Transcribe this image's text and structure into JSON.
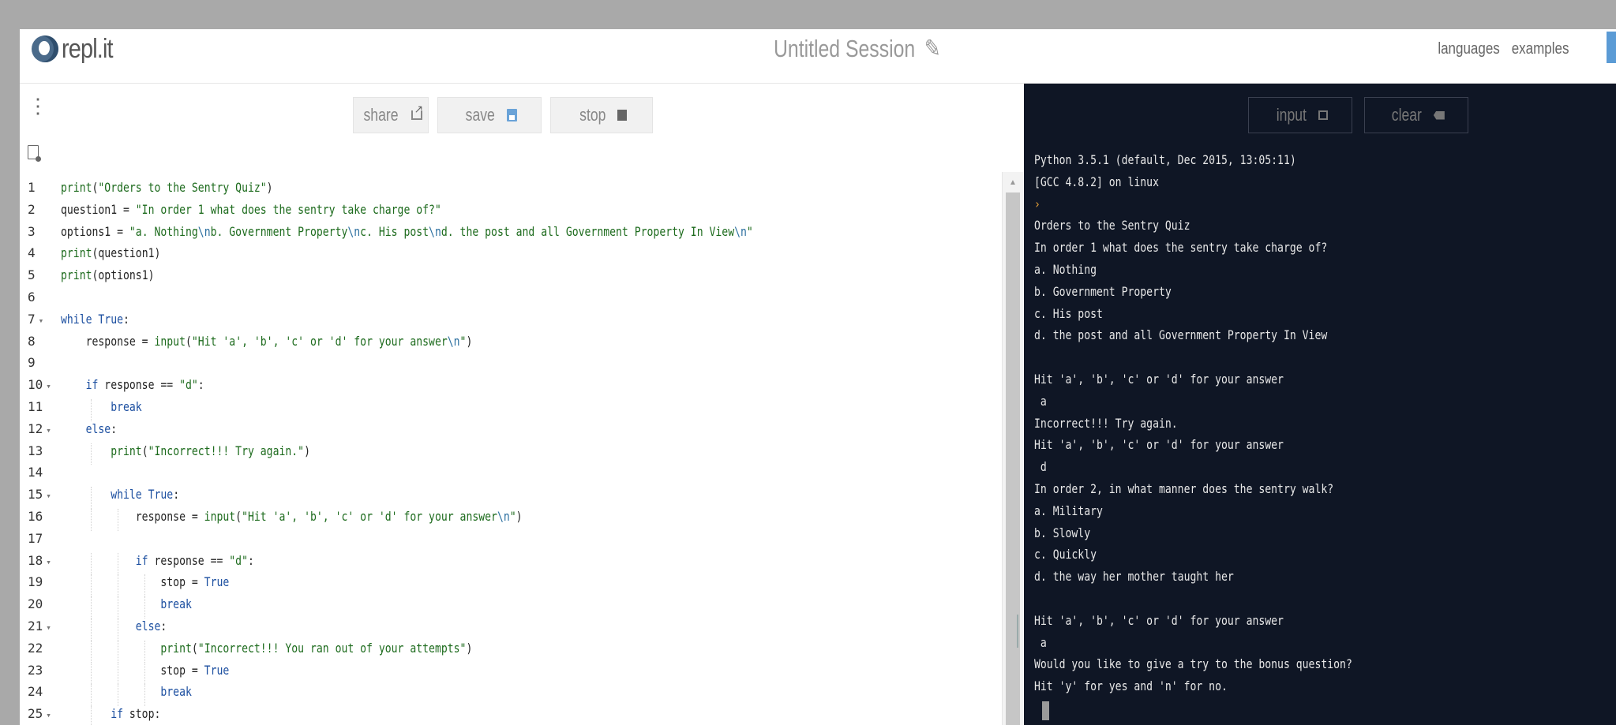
{
  "header": {
    "logo_text": "repl.it",
    "session_title": "Untitled Session",
    "nav": [
      "languages",
      "examples"
    ]
  },
  "toolbar": {
    "share_label": "share",
    "save_label": "save",
    "stop_label": "stop"
  },
  "console_toolbar": {
    "input_label": "input",
    "clear_label": "clear"
  },
  "editor": {
    "line_numbers": [
      "1",
      "2",
      "3",
      "4",
      "5",
      "6",
      "7",
      "8",
      "9",
      "10",
      "11",
      "12",
      "13",
      "14",
      "15",
      "16",
      "17",
      "18",
      "19",
      "20",
      "21",
      "22",
      "23",
      "24",
      "25"
    ],
    "folded_lines": [
      "7",
      "10",
      "12",
      "15",
      "18",
      "21",
      "25"
    ],
    "lines": [
      "print(\"Orders to the Sentry Quiz\")",
      "question1 = \"In order 1 what does the sentry take charge of?\"",
      "options1 = \"a. Nothing\\nb. Government Property\\nc. His post\\nd. the post and all Government Property In View\\n\"",
      "print(question1)",
      "print(options1)",
      "",
      "while True:",
      "    response = input(\"Hit 'a', 'b', 'c' or 'd' for your answer\\n\")",
      "",
      "    if response == \"d\":",
      "        break",
      "    else:",
      "        print(\"Incorrect!!! Try again.\")",
      "",
      "        while True:",
      "            response = input(\"Hit 'a', 'b', 'c' or 'd' for your answer\\n\")",
      "",
      "            if response == \"d\":",
      "                stop = True",
      "                break",
      "            else:",
      "                print(\"Incorrect!!! You ran out of your attempts\")",
      "                stop = True",
      "                break",
      "        if stop:"
    ]
  },
  "console": {
    "lines": [
      "Python 3.5.1 (default, Dec 2015, 13:05:11)",
      "[GCC 4.8.2] on linux",
      "›",
      "Orders to the Sentry Quiz",
      "In order 1 what does the sentry take charge of?",
      "a. Nothing",
      "b. Government Property",
      "c. His post",
      "d. the post and all Government Property In View",
      "",
      "Hit 'a', 'b', 'c' or 'd' for your answer",
      " a",
      "Incorrect!!! Try again.",
      "Hit 'a', 'b', 'c' or 'd' for your answer",
      " d",
      "In order 2, in what manner does the sentry walk?",
      "a. Military",
      "b. Slowly",
      "c. Quickly",
      "d. the way her mother taught her",
      "",
      "Hit 'a', 'b', 'c' or 'd' for your answer",
      " a",
      "Would you like to give a try to the bonus question?",
      "Hit 'y' for yes and 'n' for no."
    ]
  },
  "colors": {
    "console_bg": "#0f1625",
    "keyword": "#1c4fa0",
    "string": "#1d6b1d",
    "prompt": "#e8a33a"
  }
}
